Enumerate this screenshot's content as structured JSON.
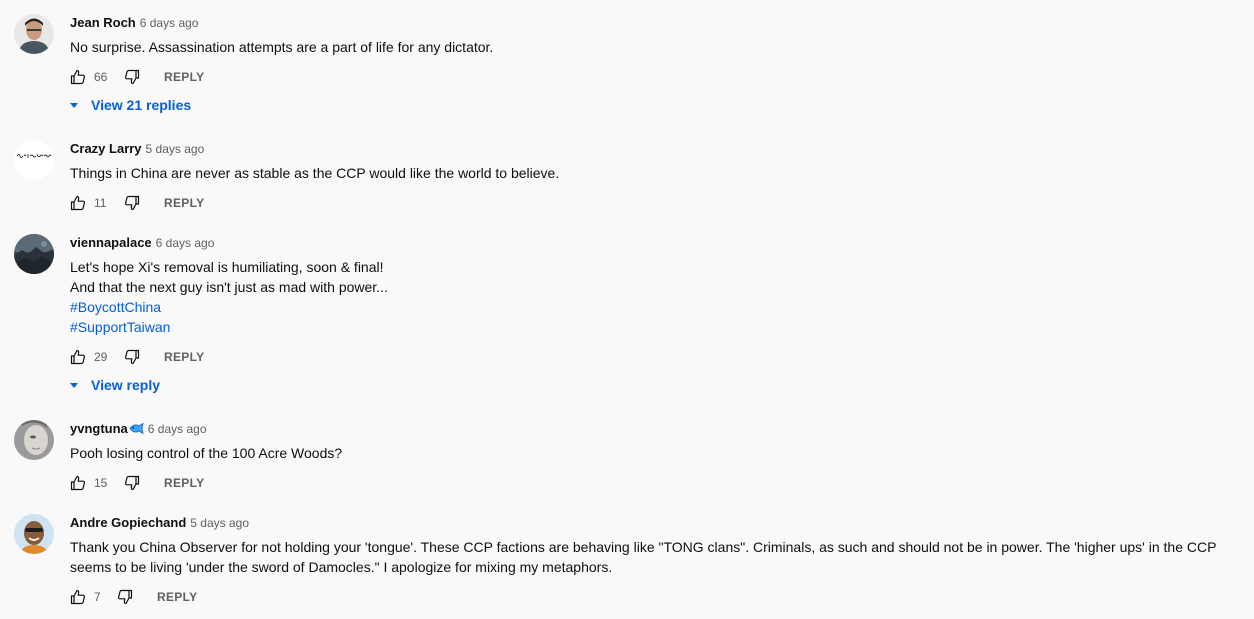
{
  "comments": [
    {
      "author": "Jean Roch",
      "time": "6 days ago",
      "lines": [
        "No surprise. Assassination attempts are a part of life for any dictator."
      ],
      "likes": "66",
      "reply_label": "REPLY",
      "replies_label": "View 21 replies",
      "avatar_icon": "person-photo-avatar"
    },
    {
      "author": "Crazy Larry",
      "time": "5 days ago",
      "lines": [
        "Things in China are never as stable as the CCP would like the world to believe."
      ],
      "likes": "11",
      "reply_label": "REPLY",
      "avatar_icon": "we-the-people-script-avatar"
    },
    {
      "author": "viennapalace",
      "time": "6 days ago",
      "lines": [
        "Let's hope Xi's removal is humiliating, soon & final!",
        "And that the next guy isn't just as mad with power..."
      ],
      "hashtags": [
        "#BoycottChina",
        "#SupportTaiwan"
      ],
      "likes": "29",
      "reply_label": "REPLY",
      "replies_label": "View reply",
      "avatar_icon": "landscape-photo-avatar"
    },
    {
      "author": "yvngtuna",
      "time": "6 days ago",
      "lines": [
        "Pooh losing control of the 100 Acre Woods?"
      ],
      "likes": "15",
      "reply_label": "REPLY",
      "badge_icon": "fish-emoji-icon",
      "avatar_icon": "face-photo-avatar"
    },
    {
      "author": "Andre Gopiechand",
      "time": "5 days ago",
      "lines": [
        "Thank you China Observer for not holding your 'tongue'.  These CCP factions are behaving like \"TONG clans\". Criminals,  as such and should not be in power. The 'higher ups' in the CCP seems to be living 'under the sword of Damocles.\" I apologize for mixing my metaphors."
      ],
      "likes": "7",
      "reply_label": "REPLY",
      "avatar_icon": "smiling-man-photo-avatar"
    }
  ],
  "colors": {
    "background": "#f9f9f9",
    "text": "#0f0f0f",
    "secondary_text": "#606060",
    "link": "#065fd4"
  }
}
